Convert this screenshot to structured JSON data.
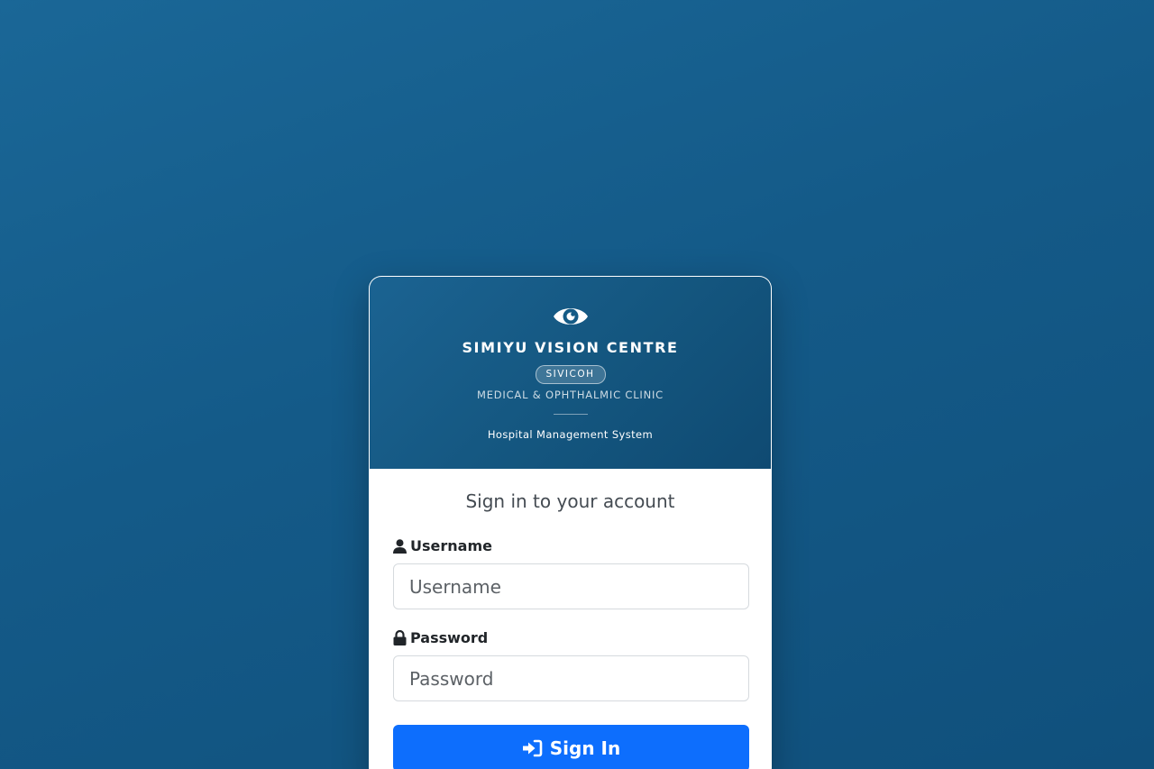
{
  "header": {
    "logo_icon": "eye-icon",
    "clinic_name": "SIMIYU VISION CENTRE",
    "badge": "SIVICOH",
    "tagline": "MEDICAL & OPHTHALMIC CLINIC",
    "system_name": "Hospital Management System"
  },
  "form": {
    "title": "Sign in to your account",
    "username": {
      "icon": "user-icon",
      "label": "Username",
      "placeholder": "Username",
      "value": ""
    },
    "password": {
      "icon": "lock-icon",
      "label": "Password",
      "placeholder": "Password",
      "value": ""
    },
    "submit": {
      "icon": "sign-in-icon",
      "label": "Sign In"
    }
  },
  "colors": {
    "background": "#145a88",
    "header": "#14567f",
    "primary_button": "#0d6efd"
  }
}
